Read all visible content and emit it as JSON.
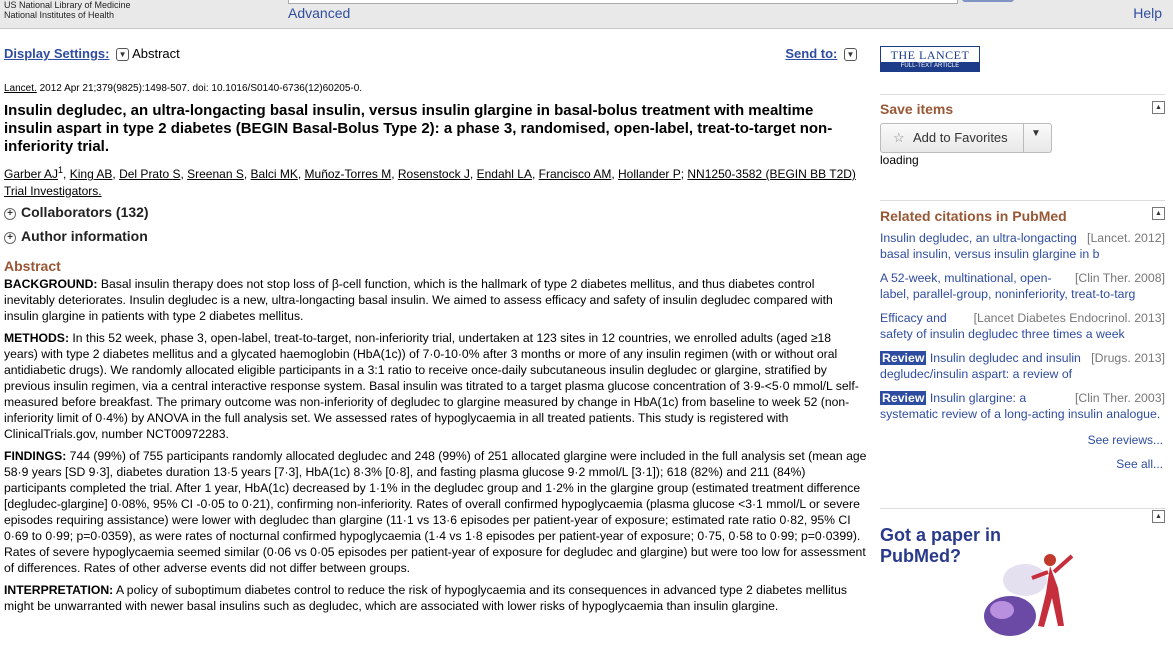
{
  "header": {
    "nlm_line1": "US National Library of Medicine",
    "nlm_line2": "National Institutes of Health",
    "advanced": "Advanced",
    "help": "Help"
  },
  "toolbar": {
    "display_settings": "Display Settings:",
    "display_value": "Abstract",
    "send_to": "Send to:"
  },
  "citation": {
    "journal": "Lancet.",
    "details": " 2012 Apr 21;379(9825):1498-507. doi: 10.1016/S0140-6736(12)60205-0."
  },
  "title": "Insulin degludec, an ultra-longacting basal insulin, versus insulin glargine in basal-bolus treatment with mealtime insulin aspart in type 2 diabetes (BEGIN Basal-Bolus Type 2): a phase 3, randomised, open-label, treat-to-target non-inferiority trial.",
  "authors": [
    "Garber AJ",
    "King AB",
    "Del Prato S",
    "Sreenan S",
    "Balci MK",
    "Muñoz-Torres M",
    "Rosenstock J",
    "Endahl LA",
    "Francisco AM",
    "Hollander P",
    "NN1250-3582 (BEGIN BB T2D) Trial Investigators."
  ],
  "first_author_sup": "1",
  "collaborators": "Collaborators (132)",
  "author_info": "Author information",
  "abstract": {
    "heading": "Abstract",
    "sections": [
      {
        "label": "BACKGROUND:",
        "text": " Basal insulin therapy does not stop loss of β-cell function, which is the hallmark of type 2 diabetes mellitus, and thus diabetes control inevitably deteriorates. Insulin degludec is a new, ultra-longacting basal insulin. We aimed to assess efficacy and safety of insulin degludec compared with insulin glargine in patients with type 2 diabetes mellitus."
      },
      {
        "label": "METHODS:",
        "text": " In this 52 week, phase 3, open-label, treat-to-target, non-inferiority trial, undertaken at 123 sites in 12 countries, we enrolled adults (aged ≥18 years) with type 2 diabetes mellitus and a glycated haemoglobin (HbA(1c)) of 7·0-10·0% after 3 months or more of any insulin regimen (with or without oral antidiabetic drugs). We randomly allocated eligible participants in a 3:1 ratio to receive once-daily subcutaneous insulin degludec or glargine, stratified by previous insulin regimen, via a central interactive response system. Basal insulin was titrated to a target plasma glucose concentration of 3·9-<5·0 mmol/L self-measured before breakfast. The primary outcome was non-inferiority of degludec to glargine measured by change in HbA(1c) from baseline to week 52 (non-inferiority limit of 0·4%) by ANOVA in the full analysis set. We assessed rates of hypoglycaemia in all treated patients. This study is registered with ClinicalTrials.gov, number NCT00972283."
      },
      {
        "label": "FINDINGS:",
        "text": " 744 (99%) of 755 participants randomly allocated degludec and 248 (99%) of 251 allocated glargine were included in the full analysis set (mean age 58·9 years [SD 9·3], diabetes duration 13·5 years [7·3], HbA(1c) 8·3% [0·8], and fasting plasma glucose 9·2 mmol/L [3·1]); 618 (82%) and 211 (84%) participants completed the trial. After 1 year, HbA(1c) decreased by 1·1% in the degludec group and 1·2% in the glargine group (estimated treatment difference [degludec-glargine] 0·08%, 95% CI -0·05 to 0·21), confirming non-inferiority. Rates of overall confirmed hypoglycaemia (plasma glucose <3·1 mmol/L or severe episodes requiring assistance) were lower with degludec than glargine (11·1 vs 13·6 episodes per patient-year of exposure; estimated rate ratio 0·82, 95% CI 0·69 to 0·99; p=0·0359), as were rates of nocturnal confirmed hypoglycaemia (1·4 vs 1·8 episodes per patient-year of exposure; 0·75, 0·58 to 0·99; p=0·0399). Rates of severe hypoglycaemia seemed similar (0·06 vs 0·05 episodes per patient-year of exposure for degludec and glargine) but were too low for assessment of differences. Rates of other adverse events did not differ between groups."
      },
      {
        "label": "INTERPRETATION:",
        "text": " A policy of suboptimum diabetes control to reduce the risk of hypoglycaemia and its consequences in advanced type 2 diabetes mellitus might be unwarranted with newer basal insulins such as degludec, which are associated with lower risks of hypoglycaemia than insulin glargine."
      }
    ]
  },
  "sidebar": {
    "lancet_title": "THE LANCET",
    "lancet_sub": "FULL-TEXT ARTICLE",
    "save_items": "Save items",
    "add_favorites": "Add to Favorites",
    "loading": "loading",
    "related_heading": "Related citations in PubMed",
    "related": [
      {
        "badge": "",
        "text": "Insulin degludec, an ultra-longacting basal insulin, versus insulin glargine in b",
        "source": "[Lancet. 2012]"
      },
      {
        "badge": "",
        "text": "A 52-week, multinational, open-label, parallel-group, noninferiority, treat-to-targ",
        "source": "[Clin Ther. 2008]"
      },
      {
        "badge": "",
        "text": "Efficacy and safety of insulin degludec three times a week",
        "source": "[Lancet Diabetes Endocrinol. 2013]"
      },
      {
        "badge": "Review",
        "text": "Insulin degludec and insulin degludec/insulin aspart: a review of",
        "source": "[Drugs. 2013]"
      },
      {
        "badge": "Review",
        "text": "Insulin glargine: a systematic review of a long-acting insulin analogue.",
        "source": "[Clin Ther. 2003]"
      }
    ],
    "see_reviews": "See reviews...",
    "see_all": "See all...",
    "got_paper_1": "Got a paper in",
    "got_paper_2": "PubMed?"
  }
}
